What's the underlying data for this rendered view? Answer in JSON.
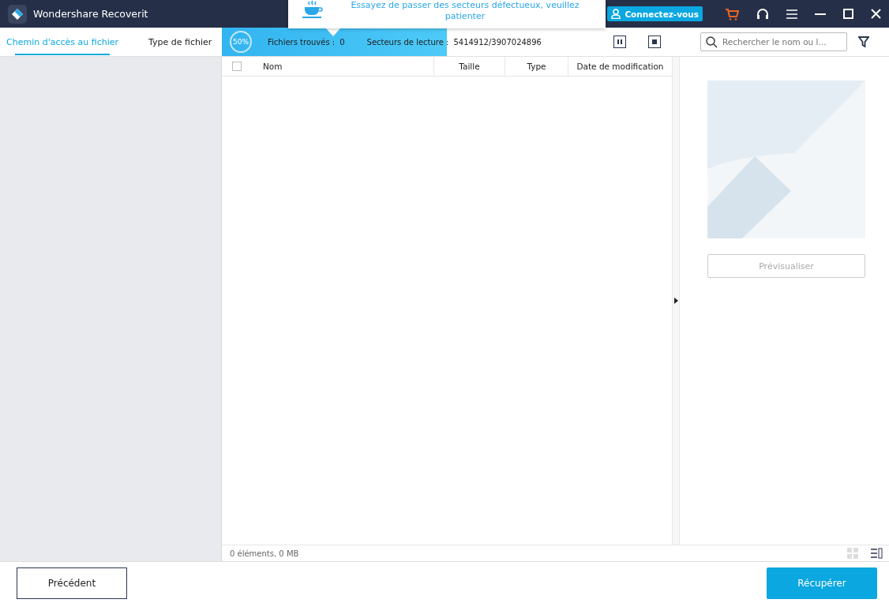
{
  "window": {
    "title": "Wondershare Recoverit",
    "login": "Connectez-vous"
  },
  "tooltip": {
    "text": "Essayez de passer des secteurs défectueux, veuillez patienter"
  },
  "tabs": [
    {
      "label": "Chemin d'accès au fichier",
      "selected": true
    },
    {
      "label": "Type de fichier",
      "selected": false
    }
  ],
  "scan": {
    "percent": "50%",
    "level": 0.5,
    "found_label": "Fichiers trouvés :",
    "found_value": "0",
    "sectors_label": "Secteurs de lecture :",
    "sectors_value": "5414912/3907024896"
  },
  "search": {
    "placeholder": "Rechercher le nom ou l..."
  },
  "table": {
    "select_all_checked": false,
    "columns": [
      "Nom",
      "Taille",
      "Type",
      "Date de modification"
    ]
  },
  "status": "0 éléments, 0 MB",
  "preview": {
    "button": "Prévisualiser",
    "disabled": true
  },
  "footer": {
    "back": "Précédent",
    "recover": "Récupérer"
  }
}
